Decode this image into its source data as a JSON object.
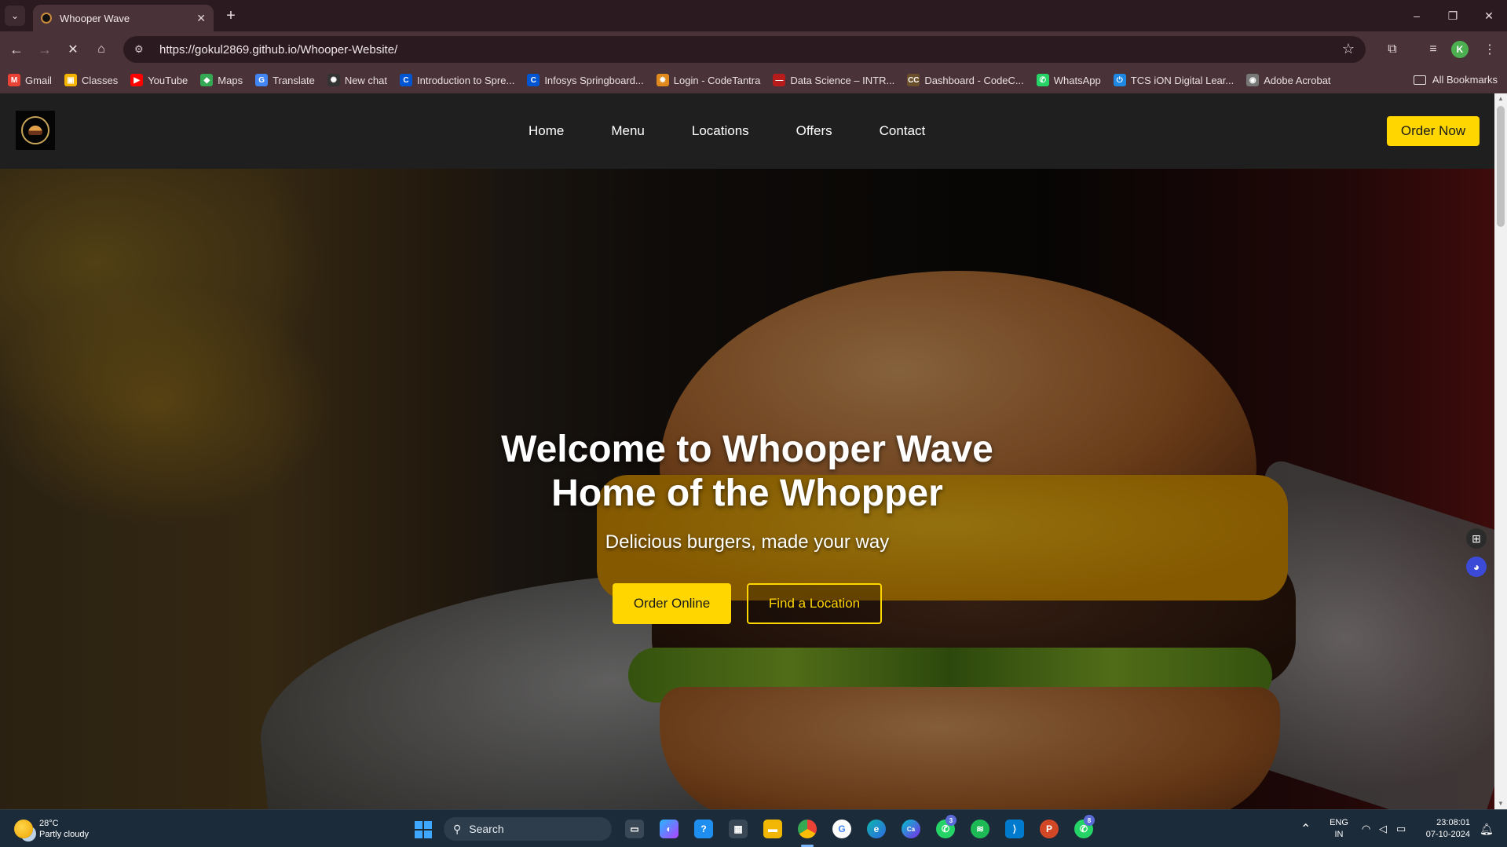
{
  "browser": {
    "tab_title": "Whooper Wave",
    "tab_close": "✕",
    "new_tab": "+",
    "url": "https://gokul2869.github.io/Whooper-Website/",
    "window_controls": [
      "–",
      "❐",
      "✕"
    ],
    "profile_initial": "K",
    "bookmarks": [
      {
        "label": "Gmail",
        "icon": "gmail-icon",
        "color": "#ea4335",
        "glyph": "M"
      },
      {
        "label": "Classes",
        "icon": "classroom-icon",
        "color": "#f4b400",
        "glyph": "▣"
      },
      {
        "label": "YouTube",
        "icon": "youtube-icon",
        "color": "#ff0000",
        "glyph": "▶"
      },
      {
        "label": "Maps",
        "icon": "maps-icon",
        "color": "#34a853",
        "glyph": "◆"
      },
      {
        "label": "Translate",
        "icon": "translate-icon",
        "color": "#4285f4",
        "glyph": "G"
      },
      {
        "label": "New chat",
        "icon": "chatgpt-icon",
        "color": "#333333",
        "glyph": "✺"
      },
      {
        "label": "Introduction to Spre...",
        "icon": "coursera-icon",
        "color": "#0056d2",
        "glyph": "C"
      },
      {
        "label": "Infosys Springboard...",
        "icon": "springboard-icon",
        "color": "#0056d2",
        "glyph": "C"
      },
      {
        "label": "Login - CodeTantra",
        "icon": "codetantra-icon",
        "color": "#e08a1e",
        "glyph": "✹"
      },
      {
        "label": "Data Science – INTR...",
        "icon": "datascience-icon",
        "color": "#b71c1c",
        "glyph": "—"
      },
      {
        "label": "Dashboard - CodeC...",
        "icon": "codechef-icon",
        "color": "#6b4f2a",
        "glyph": "CC"
      },
      {
        "label": "WhatsApp",
        "icon": "whatsapp-icon",
        "color": "#25d366",
        "glyph": "✆"
      },
      {
        "label": "TCS iON Digital Lear...",
        "icon": "tcs-ion-icon",
        "color": "#1e88e5",
        "glyph": "⏻"
      },
      {
        "label": "Adobe Acrobat",
        "icon": "acrobat-icon",
        "color": "#777777",
        "glyph": "◉"
      }
    ],
    "all_bookmarks": "All Bookmarks"
  },
  "site": {
    "nav": [
      "Home",
      "Menu",
      "Locations",
      "Offers",
      "Contact"
    ],
    "order_now": "Order Now",
    "hero": {
      "title_line1": "Welcome to Whooper Wave",
      "title_line2": "Home of the Whopper",
      "subtitle": "Delicious burgers, made your way",
      "btn_order_online": "Order Online",
      "btn_find_location": "Find a Location"
    },
    "accent_color": "#ffd600"
  },
  "taskbar": {
    "weather_temp": "28°C",
    "weather_desc": "Partly cloudy",
    "search_placeholder": "Search",
    "lang_line1": "ENG",
    "lang_line2": "IN",
    "time": "23:08:01",
    "date": "07-10-2024",
    "whatsapp_badge": "3",
    "whatsapp2_badge": "8"
  }
}
